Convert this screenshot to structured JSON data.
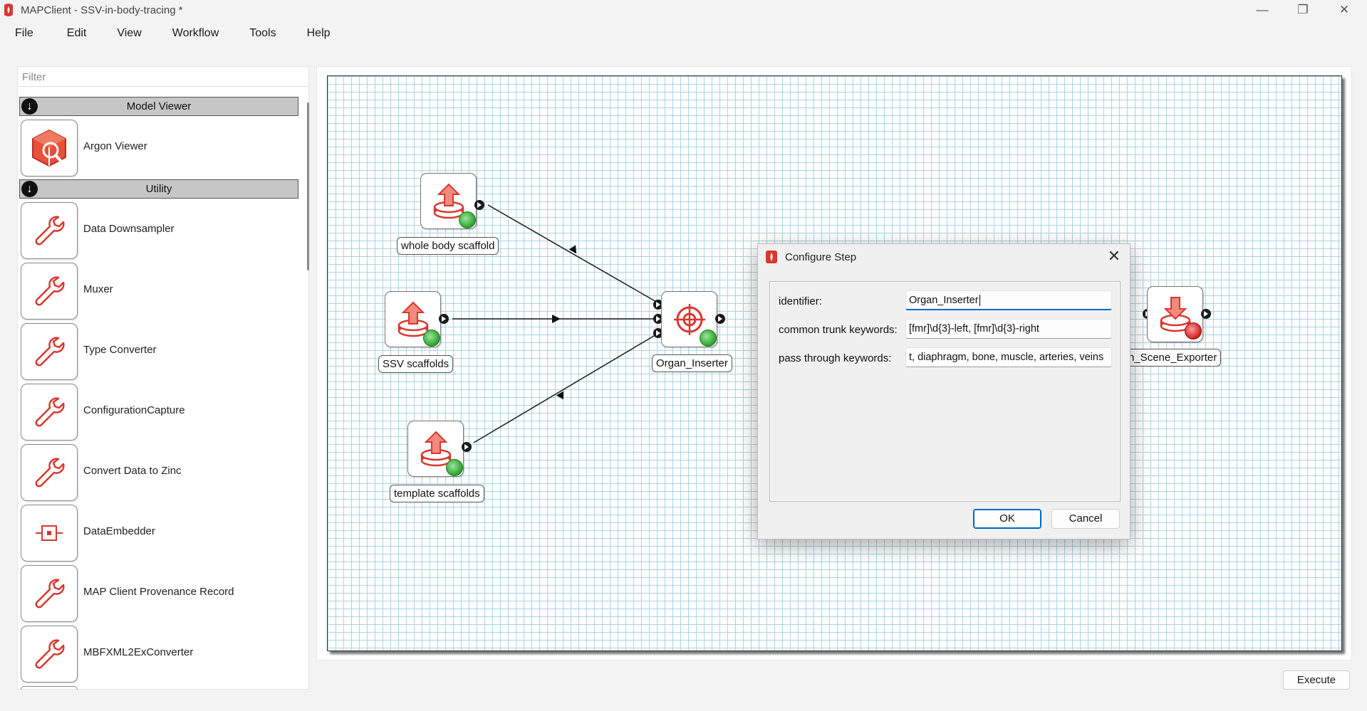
{
  "window": {
    "title": "MAPClient - SSV-in-body-tracing *",
    "minimize_glyph": "—",
    "maximize_glyph": "❐",
    "close_glyph": "✕"
  },
  "menu": [
    "File",
    "Edit",
    "View",
    "Workflow",
    "Tools",
    "Help"
  ],
  "left_panel": {
    "filter_placeholder": "Filter",
    "groups": [
      {
        "name": "Model Viewer",
        "items": [
          "Argon Viewer"
        ]
      },
      {
        "name": "Utility",
        "items": [
          "Data Downsampler",
          "Muxer",
          "Type Converter",
          "ConfigurationCapture",
          "Convert Data to Zinc",
          "DataEmbedder",
          "MAP Client Provenance Record",
          "MBFXML2ExConverter"
        ]
      }
    ]
  },
  "workflow": {
    "nodes": [
      {
        "label": "whole body scaffold",
        "icon": "file-upload-icon",
        "status": "configured"
      },
      {
        "label": "SSV scaffolds",
        "icon": "file-upload-icon",
        "status": "configured"
      },
      {
        "label": "template scaffolds",
        "icon": "file-upload-icon",
        "status": "configured"
      },
      {
        "label": "Organ_Inserter",
        "icon": "target-icon",
        "status": "configured"
      },
      {
        "label": "n_Scene_Exporter",
        "icon": "file-download-icon",
        "status": "unconfigured"
      }
    ]
  },
  "dialog": {
    "title": "Configure Step",
    "close_glyph": "✕",
    "fields": [
      {
        "label": "identifier:",
        "value": "Organ_Inserter"
      },
      {
        "label": "common trunk keywords:",
        "value": "[fmr]\\d{3}-left, [fmr]\\d{3}-right"
      },
      {
        "label": "pass through keywords:",
        "value": "t, diaphragm, bone, muscle, arteries, veins"
      }
    ],
    "ok_label": "OK",
    "cancel_label": "Cancel"
  },
  "execute_label": "Execute",
  "colors": {
    "accent": "#0067c0",
    "brand_red": "#d8382f",
    "grid_line": "#a9d3e4",
    "group_header": "#c6c6c6"
  }
}
